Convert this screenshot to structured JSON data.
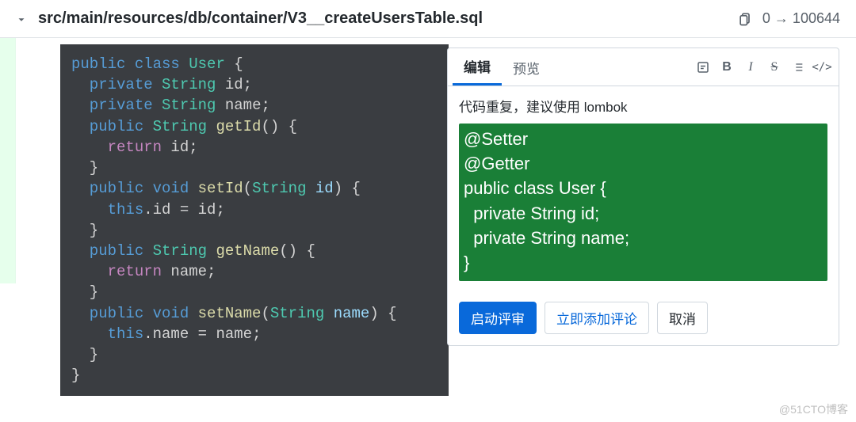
{
  "header": {
    "file_path": "src/main/resources/db/container/V3__createUsersTable.sql",
    "mode_change": "0 → 100644"
  },
  "code": {
    "lines": [
      {
        "t": "public class ",
        "c": "blue"
      },
      {
        "t": "User ",
        "c": "teal"
      },
      {
        "t": "{",
        "c": ""
      },
      {
        "nl": true
      },
      {
        "t": "  private ",
        "c": "blue"
      },
      {
        "t": "String ",
        "c": "teal"
      },
      {
        "t": "id",
        "c": ""
      },
      {
        "t": ";",
        "c": ""
      },
      {
        "nl": true
      },
      {
        "t": "  private ",
        "c": "blue"
      },
      {
        "t": "String ",
        "c": "teal"
      },
      {
        "t": "name",
        "c": ""
      },
      {
        "t": ";",
        "c": ""
      },
      {
        "nl": true
      },
      {
        "t": "  public ",
        "c": "blue"
      },
      {
        "t": "String ",
        "c": "teal"
      },
      {
        "t": "getId",
        "c": "yellow"
      },
      {
        "t": "() {",
        "c": ""
      },
      {
        "nl": true
      },
      {
        "t": "    return ",
        "c": "purple"
      },
      {
        "t": "id",
        "c": ""
      },
      {
        "t": ";",
        "c": ""
      },
      {
        "nl": true
      },
      {
        "t": "  }",
        "c": ""
      },
      {
        "nl": true
      },
      {
        "t": "  public ",
        "c": "blue"
      },
      {
        "t": "void ",
        "c": "blue"
      },
      {
        "t": "setId",
        "c": "yellow"
      },
      {
        "t": "(",
        "c": ""
      },
      {
        "t": "String ",
        "c": "teal"
      },
      {
        "t": "id",
        "c": "cyan"
      },
      {
        "t": ") {",
        "c": ""
      },
      {
        "nl": true
      },
      {
        "t": "    this",
        "c": "blue"
      },
      {
        "t": ".",
        "c": ""
      },
      {
        "t": "id",
        "c": ""
      },
      {
        "t": " = ",
        "c": ""
      },
      {
        "t": "id",
        "c": ""
      },
      {
        "t": ";",
        "c": ""
      },
      {
        "nl": true
      },
      {
        "t": "  }",
        "c": ""
      },
      {
        "nl": true
      },
      {
        "t": "  public ",
        "c": "blue"
      },
      {
        "t": "String ",
        "c": "teal"
      },
      {
        "t": "getName",
        "c": "yellow"
      },
      {
        "t": "() {",
        "c": ""
      },
      {
        "nl": true
      },
      {
        "t": "    return ",
        "c": "purple"
      },
      {
        "t": "name",
        "c": ""
      },
      {
        "t": ";",
        "c": ""
      },
      {
        "nl": true
      },
      {
        "t": "  }",
        "c": ""
      },
      {
        "nl": true
      },
      {
        "t": "  public ",
        "c": "blue"
      },
      {
        "t": "void ",
        "c": "blue"
      },
      {
        "t": "setName",
        "c": "yellow"
      },
      {
        "t": "(",
        "c": ""
      },
      {
        "t": "String ",
        "c": "teal"
      },
      {
        "t": "name",
        "c": "cyan"
      },
      {
        "t": ") {",
        "c": ""
      },
      {
        "nl": true
      },
      {
        "t": "    this",
        "c": "blue"
      },
      {
        "t": ".",
        "c": ""
      },
      {
        "t": "name",
        "c": ""
      },
      {
        "t": " = ",
        "c": ""
      },
      {
        "t": "name",
        "c": ""
      },
      {
        "t": ";",
        "c": ""
      },
      {
        "nl": true
      },
      {
        "t": "  }",
        "c": ""
      },
      {
        "nl": true
      },
      {
        "t": "}",
        "c": ""
      }
    ]
  },
  "comment": {
    "tabs": {
      "edit": "编辑",
      "preview": "预览"
    },
    "icons": {
      "suggestion": "suggestion-icon",
      "bold_glyph": "B",
      "italic_glyph": "I",
      "strike_glyph": "S",
      "list": "list-icon",
      "code_glyph": "</>"
    },
    "text": "代码重复，建议使用 lombok",
    "suggestion": "@Setter\n@Getter\npublic class User {\n  private String id;\n  private String name;\n}",
    "buttons": {
      "start_review": "启动评审",
      "add_comment_now": "立即添加评论",
      "cancel": "取消"
    }
  },
  "watermark": "@51CTO博客"
}
